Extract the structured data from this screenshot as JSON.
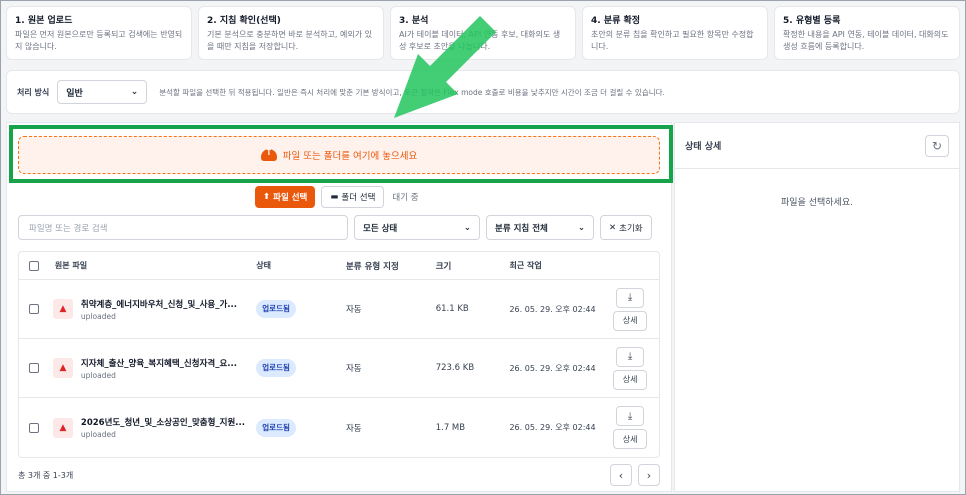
{
  "steps": [
    {
      "title": "1. 원본 업로드",
      "desc": "파일은 먼저 원본으로만 등록되고 검색에는 반영되지 않습니다."
    },
    {
      "title": "2. 지침 확인(선택)",
      "desc": "기본 분석으로 충분하면 바로 분석하고, 예외가 있을 때만 지침을 저장합니다."
    },
    {
      "title": "3. 분석",
      "desc": "AI가 테이블 데이터, API 연동 후보, 대화의도 생성 후보로 초안을 나눕니다."
    },
    {
      "title": "4. 분류 확정",
      "desc": "초안의 분류 칩을 확인하고 필요한 항목만 수정합니다."
    },
    {
      "title": "5. 유형별 등록",
      "desc": "확정한 내용을 API 연동, 테이블 데이터, 대화의도 생성 흐름에 등록합니다."
    }
  ],
  "mode": {
    "label": "처리 방식",
    "value": "일반",
    "desc": "분석할 파일을 선택한 뒤 적용됩니다. 일반은 즉시 처리에 맞춘 기본 방식이고, 토큰 절약은 Flex mode 호출로 비용을 낮추지만 시간이 조금 더 걸릴 수 있습니다."
  },
  "dropzone": {
    "text": "파일 또는 폴더를 여기에 놓으세요"
  },
  "actions": {
    "file_select": "파일 선택",
    "folder_select": "폴더 선택",
    "status": "대기 중"
  },
  "filters": {
    "search_placeholder": "파일명 또는 경로 검색",
    "status_value": "모든 상태",
    "guide_value": "분류 지침 전체",
    "reset": "초기화"
  },
  "table": {
    "headers": [
      "원본 파일",
      "상태",
      "분류 유형 지정",
      "크기",
      "최근 작업"
    ],
    "rows": [
      {
        "name": "취약계층_에너지바우처_신청_및_사용_가...",
        "sub": "uploaded",
        "status": "업로드됨",
        "type": "자동",
        "size": "61.1 KB",
        "time": "26. 05. 29. 오후 02:44",
        "detail": "상세"
      },
      {
        "name": "지자체_출산_양육_복지혜택_신청자격_요...",
        "sub": "uploaded",
        "status": "업로드됨",
        "type": "자동",
        "size": "723.6 KB",
        "time": "26. 05. 29. 오후 02:44",
        "detail": "상세"
      },
      {
        "name": "2026년도_청년_및_소상공인_맞춤형_지원...",
        "sub": "uploaded",
        "status": "업로드됨",
        "type": "자동",
        "size": "1.7 MB",
        "time": "26. 05. 29. 오후 02:44",
        "detail": "상세"
      }
    ]
  },
  "footer": {
    "count": "총 3개 중 1-3개"
  },
  "side": {
    "title": "상태 상세",
    "empty": "파일을 선택하세요."
  },
  "colors": {
    "accent": "#ea580c",
    "highlight": "#16a34a",
    "arrow": "#22c55e",
    "badge": "#dbeafe"
  }
}
